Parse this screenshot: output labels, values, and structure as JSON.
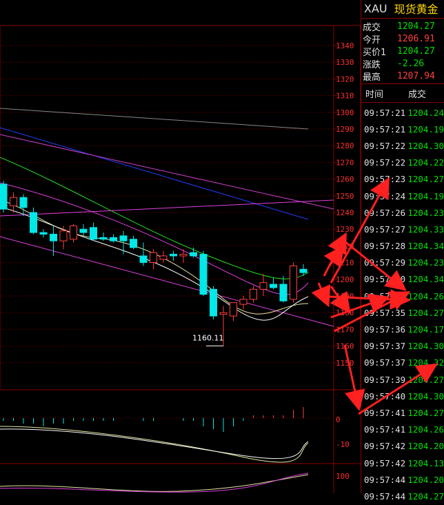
{
  "quote": {
    "symbol": "XAU",
    "name": "现货黄金",
    "rows": [
      {
        "label": "成交",
        "value": "1204.27",
        "color": "#00e000"
      },
      {
        "label": "今开",
        "value": "1206.91",
        "color": "#ff4040"
      },
      {
        "label": "买价1",
        "value": "1204.27",
        "color": "#00e000"
      },
      {
        "label": "涨跌",
        "value": "-2.26",
        "color": "#00e000"
      },
      {
        "label": "最高",
        "value": "1207.94",
        "color": "#ff4040"
      }
    ],
    "ticks_header": {
      "time": "时间",
      "price": "成交"
    },
    "ticks": [
      {
        "time": "09:57:21",
        "price": "1204.24"
      },
      {
        "time": "09:57:21",
        "price": "1204.19"
      },
      {
        "time": "09:57:22",
        "price": "1204.30"
      },
      {
        "time": "09:57:22",
        "price": "1204.22"
      },
      {
        "time": "09:57:23",
        "price": "1204.27"
      },
      {
        "time": "09:57:24",
        "price": "1204.19"
      },
      {
        "time": "09:57:26",
        "price": "1204.23"
      },
      {
        "time": "09:57:27",
        "price": "1204.33"
      },
      {
        "time": "09:57:28",
        "price": "1204.34"
      },
      {
        "time": "09:57:29",
        "price": "1204.23"
      },
      {
        "time": "09:57:30",
        "price": "1204.34"
      },
      {
        "time": "09:57:31",
        "price": "1204.26"
      },
      {
        "time": "09:57:35",
        "price": "1204.27"
      },
      {
        "time": "09:57:36",
        "price": "1204.17"
      },
      {
        "time": "09:57:37",
        "price": "1204.30"
      },
      {
        "time": "09:57:37",
        "price": "1204.32"
      },
      {
        "time": "09:57:39",
        "price": "1204.27"
      },
      {
        "time": "09:57:40",
        "price": "1204.30"
      },
      {
        "time": "09:57:41",
        "price": "1204.27"
      },
      {
        "time": "09:57:41",
        "price": "1204.26"
      },
      {
        "time": "09:57:42",
        "price": "1204.20"
      },
      {
        "time": "09:57:42",
        "price": "1204.13"
      },
      {
        "time": "09:57:44",
        "price": "1204.20"
      },
      {
        "time": "09:57:44",
        "price": "1204.27"
      }
    ]
  },
  "chart": {
    "price_axis_labels": [
      "1340",
      "1330",
      "1320",
      "1310",
      "1300",
      "1290",
      "1280",
      "1270",
      "1260",
      "1250",
      "1240",
      "1230",
      "1220",
      "1210",
      "1200",
      "1190",
      "1180",
      "1170",
      "1160",
      "1150"
    ],
    "low_label": "1160.11",
    "macd_axis_labels": [
      "0",
      "-10"
    ],
    "kdj_axis_labels": [
      "100"
    ],
    "colors": {
      "up": "#ff4040",
      "down": "#00e8e8",
      "grid": "#8b0000"
    }
  },
  "chart_data": {
    "type": "candlestick",
    "candles": [
      {
        "o": 1257,
        "h": 1259,
        "l": 1240,
        "c": 1242
      },
      {
        "o": 1244,
        "h": 1252,
        "l": 1240,
        "c": 1249
      },
      {
        "o": 1249,
        "h": 1251,
        "l": 1238,
        "c": 1243
      },
      {
        "o": 1240,
        "h": 1243,
        "l": 1227,
        "c": 1228
      },
      {
        "o": 1228,
        "h": 1230,
        "l": 1225,
        "c": 1227
      },
      {
        "o": 1227,
        "h": 1232,
        "l": 1214,
        "c": 1223
      },
      {
        "o": 1223,
        "h": 1232,
        "l": 1218,
        "c": 1229
      },
      {
        "o": 1224,
        "h": 1233,
        "l": 1222,
        "c": 1232
      },
      {
        "o": 1230,
        "h": 1233,
        "l": 1226,
        "c": 1228
      },
      {
        "o": 1231,
        "h": 1234,
        "l": 1223,
        "c": 1224
      },
      {
        "o": 1225,
        "h": 1228,
        "l": 1223,
        "c": 1224
      },
      {
        "o": 1225,
        "h": 1227,
        "l": 1222,
        "c": 1223
      },
      {
        "o": 1226,
        "h": 1229,
        "l": 1215,
        "c": 1223
      },
      {
        "o": 1224,
        "h": 1226,
        "l": 1218,
        "c": 1219
      },
      {
        "o": 1214,
        "h": 1222,
        "l": 1208,
        "c": 1210
      },
      {
        "o": 1210,
        "h": 1218,
        "l": 1206,
        "c": 1216
      },
      {
        "o": 1212,
        "h": 1217,
        "l": 1210,
        "c": 1214
      },
      {
        "o": 1215,
        "h": 1217,
        "l": 1211,
        "c": 1214
      },
      {
        "o": 1214,
        "h": 1218,
        "l": 1210,
        "c": 1215
      },
      {
        "o": 1216,
        "h": 1219,
        "l": 1213,
        "c": 1214
      },
      {
        "o": 1215,
        "h": 1217,
        "l": 1190,
        "c": 1191
      },
      {
        "o": 1194,
        "h": 1196,
        "l": 1176,
        "c": 1178
      },
      {
        "o": 1179,
        "h": 1184,
        "l": 1160.11,
        "c": 1180
      },
      {
        "o": 1178,
        "h": 1186,
        "l": 1175,
        "c": 1186
      },
      {
        "o": 1185,
        "h": 1190,
        "l": 1182,
        "c": 1188
      },
      {
        "o": 1188,
        "h": 1196,
        "l": 1186,
        "c": 1194
      },
      {
        "o": 1194,
        "h": 1203,
        "l": 1190,
        "c": 1198
      },
      {
        "o": 1197,
        "h": 1201,
        "l": 1194,
        "c": 1195
      },
      {
        "o": 1197,
        "h": 1202,
        "l": 1186,
        "c": 1187
      },
      {
        "o": 1188,
        "h": 1210,
        "l": 1186,
        "c": 1208
      },
      {
        "o": 1206,
        "h": 1209,
        "l": 1202,
        "c": 1204
      }
    ],
    "macd_hist": [
      -1,
      -1,
      -2,
      -2,
      -3,
      -2,
      -2,
      -1,
      -1,
      -1,
      -1,
      -1,
      0,
      0,
      -1,
      -1,
      0,
      0,
      -1,
      -1,
      -3,
      -4,
      -5,
      -3,
      -1,
      1,
      1,
      1,
      1,
      3,
      4
    ]
  }
}
